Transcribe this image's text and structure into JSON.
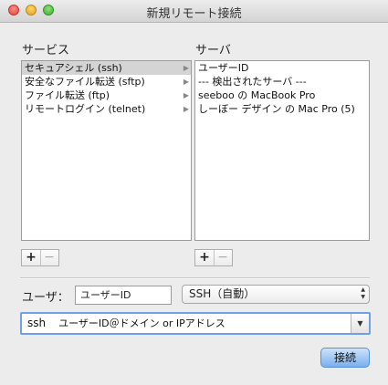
{
  "window": {
    "title": "新規リモート接続"
  },
  "services": {
    "header": "サービス",
    "items": [
      {
        "label": "セキュアシェル (ssh)",
        "selected": true
      },
      {
        "label": "安全なファイル転送 (sftp)",
        "selected": false
      },
      {
        "label": "ファイル転送 (ftp)",
        "selected": false
      },
      {
        "label": "リモートログイン (telnet)",
        "selected": false
      }
    ]
  },
  "servers": {
    "header": "サーバ",
    "items": [
      {
        "label": "ユーザーID"
      },
      {
        "label": "--- 検出されたサーバ ---"
      },
      {
        "label": "seeboo の MacBook Pro"
      },
      {
        "label": "しーぼー デザイン の Mac Pro (5)"
      }
    ]
  },
  "buttons": {
    "plus": "+",
    "minus": "−",
    "connect": "接続"
  },
  "user": {
    "label": "ユーザ：",
    "value": "ユーザーID"
  },
  "protocol_select": {
    "value": "SSH（自動）"
  },
  "command": {
    "cmd": "ssh",
    "args": "ユーザーID＠ドメイン or IPアドレス"
  },
  "icons": {
    "row_arrow": "▶",
    "combo_arrow": "▼",
    "select_up": "▲",
    "select_down": "▼"
  },
  "colors": {
    "accent": "#6ea0e2",
    "selection": "#d4d4d4",
    "default_button": "#7ab0ee"
  }
}
